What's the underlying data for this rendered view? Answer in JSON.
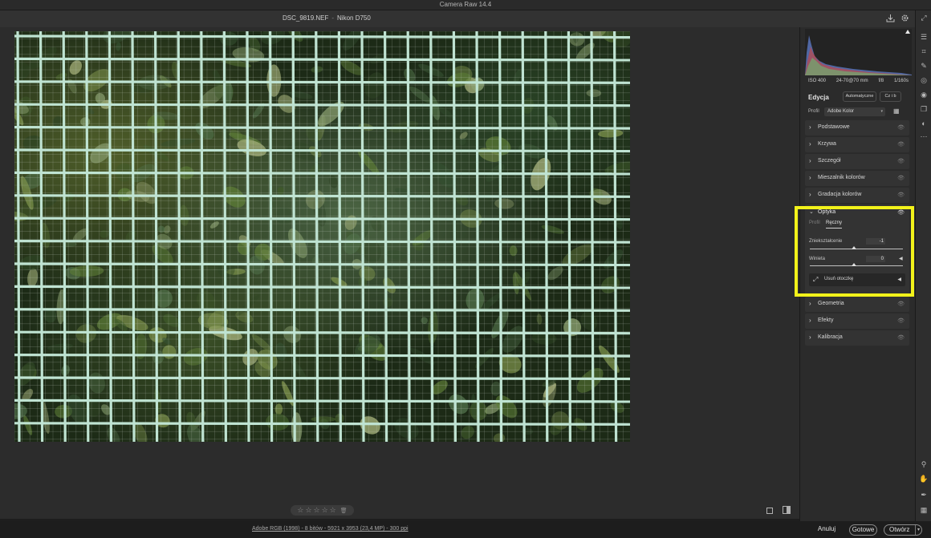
{
  "app": {
    "title": "Camera Raw 14.4"
  },
  "file": {
    "name": "DSC_9819.NEF",
    "separator": "-",
    "camera": "Nikon D750"
  },
  "colors": {
    "highlight": "#f2f21a",
    "panel": "#2b2b2b",
    "canvas": "#2c2c2c",
    "histogram_blue": "#5f7fd0",
    "histogram_red": "#c04a4a",
    "histogram_green": "#6fae6f"
  },
  "toolbar_icons": [
    "save-icon",
    "settings-icon",
    "fullscreen-icon"
  ],
  "histogram": {
    "camera_info": {
      "iso": "ISO 400",
      "lens": "24-70@70 mm",
      "aperture": "f/8",
      "shutter": "1/160s"
    }
  },
  "edit": {
    "title": "Edycja",
    "auto_label": "Automatyczne",
    "bw_label": "Cz i b",
    "profile_label": "Profil",
    "profile_value": "Adobe Kolor"
  },
  "sections": [
    {
      "label": "Podstawowe",
      "expanded": false
    },
    {
      "label": "Krzywa",
      "expanded": false
    },
    {
      "label": "Szczegół",
      "expanded": false
    },
    {
      "label": "Mieszalnik kolorów",
      "expanded": false
    },
    {
      "label": "Gradacja kolorów",
      "expanded": false
    },
    {
      "label": "Optyka",
      "expanded": true
    },
    {
      "label": "Geometria",
      "expanded": false
    },
    {
      "label": "Efekty",
      "expanded": false
    },
    {
      "label": "Kalibracja",
      "expanded": false
    }
  ],
  "optics": {
    "tabs": [
      "Profil",
      "Ręczny"
    ],
    "active_tab": "Ręczny",
    "distortion": {
      "label": "Zniekształcenie",
      "value": "-1"
    },
    "vignette": {
      "label": "Winieta",
      "value": "0"
    },
    "defringe": {
      "label": "Usuń otoczkę"
    }
  },
  "rating": {
    "stars": 0,
    "max": 5
  },
  "status": {
    "file_info": "Adobe RGB (1998) - 8 bitów - 5921 x 3953 (23,4 MP) - 300 ppi",
    "cancel_label": "Anuluj",
    "done_label": "Gotowe",
    "open_label": "Otwórz"
  },
  "right_tools": [
    "edit-sliders-icon",
    "crop-icon",
    "healing-icon",
    "mask-icon",
    "red-eye-icon",
    "presets-icon",
    "more-icon",
    "zoom-icon",
    "hand-icon",
    "sampler-icon",
    "grid-toggle-icon"
  ]
}
